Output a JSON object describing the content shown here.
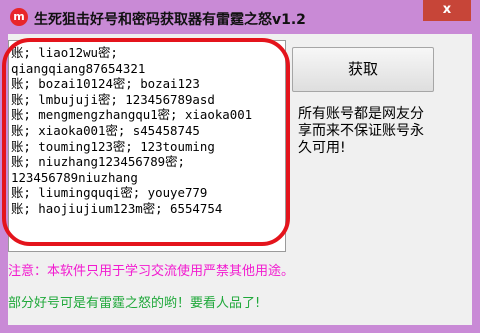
{
  "window": {
    "title": "生死狙击好号和密码获取器有雷霆之怒v1.2",
    "icon": "m",
    "close_label": "x"
  },
  "accounts_box": {
    "lines": [
      "账; liao12wu密;",
      "qiangqiang87654321",
      "账; bozai10124密; bozai123",
      "账; lmbujuji密; 123456789asd",
      "账; mengmengzhangqu1密; xiaoka001",
      "账; xiaoka001密; s45458745",
      "账; touming123密; 123touming",
      "账; niuzhang123456789密;",
      "123456789niuzhang",
      "账; liumingquqi密; youye779",
      "账; haojiujium123m密; 6554754"
    ]
  },
  "fetch_button": {
    "label": "获取"
  },
  "note": {
    "text": "所有账号都是网友分享而来不保证账号永久可用!"
  },
  "warning": {
    "text": "注意：本软件只用于学习交流使用严禁其他用途。"
  },
  "footer": {
    "text": "部分好号可是有雷霆之怒的哟！要看人品了!"
  },
  "colors": {
    "titlebar": "#c98ad6",
    "warning": "#f21ad0",
    "footer": "#1fa83a",
    "highlight": "#e4141c",
    "close": "#c74538"
  }
}
